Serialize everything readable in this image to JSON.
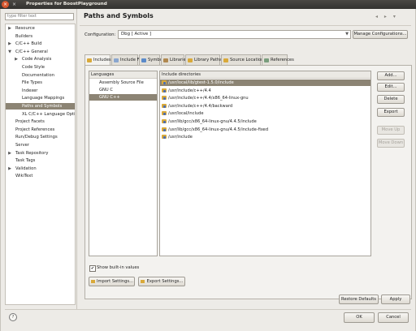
{
  "window": {
    "title": "Properties for BoostPlayground"
  },
  "filter": {
    "placeholder": "type filter text"
  },
  "tree": [
    {
      "label": "Resource",
      "expander": "▶",
      "depth": 0
    },
    {
      "label": "Builders",
      "expander": "",
      "depth": 0
    },
    {
      "label": "C/C++ Build",
      "expander": "▶",
      "depth": 0
    },
    {
      "label": "C/C++ General",
      "expander": "▼",
      "depth": 0
    },
    {
      "label": "Code Analysis",
      "expander": "▶",
      "depth": 1
    },
    {
      "label": "Code Style",
      "expander": "",
      "depth": 1
    },
    {
      "label": "Documentation",
      "expander": "",
      "depth": 1
    },
    {
      "label": "File Types",
      "expander": "",
      "depth": 1
    },
    {
      "label": "Indexer",
      "expander": "",
      "depth": 1
    },
    {
      "label": "Language Mappings",
      "expander": "",
      "depth": 1
    },
    {
      "label": "Paths and Symbols",
      "expander": "",
      "depth": 1,
      "selected": true
    },
    {
      "label": "XL C/C++ Language Opti",
      "expander": "",
      "depth": 1
    },
    {
      "label": "Project Facets",
      "expander": "",
      "depth": 0
    },
    {
      "label": "Project References",
      "expander": "",
      "depth": 0
    },
    {
      "label": "Run/Debug Settings",
      "expander": "",
      "depth": 0
    },
    {
      "label": "Server",
      "expander": "",
      "depth": 0
    },
    {
      "label": "Task Repository",
      "expander": "▶",
      "depth": 0
    },
    {
      "label": "Task Tags",
      "expander": "",
      "depth": 0
    },
    {
      "label": "Validation",
      "expander": "▶",
      "depth": 0
    },
    {
      "label": "WikiText",
      "expander": "",
      "depth": 0
    }
  ],
  "page": {
    "title": "Paths and Symbols",
    "header_icons": "◂ ▸ ▾"
  },
  "configuration": {
    "label": "Configuration:",
    "value": "Dbg  [ Active ]",
    "manage_button": "Manage Configurations..."
  },
  "tabs": [
    {
      "label": "Includes",
      "active": true,
      "icon_color": "#d9a93a"
    },
    {
      "label": "Include Files",
      "active": false,
      "icon_color": "#8aa6cf"
    },
    {
      "label": "Symbols",
      "active": false,
      "icon_color": "#5b8ac9"
    },
    {
      "label": "Libraries",
      "active": false,
      "icon_color": "#b08850"
    },
    {
      "label": "Library Paths",
      "active": false,
      "icon_color": "#d9a93a"
    },
    {
      "label": "Source Location",
      "active": false,
      "icon_color": "#d9a93a"
    },
    {
      "label": "References",
      "active": false,
      "icon_color": "#7a9e7e"
    }
  ],
  "languages": {
    "header": "Languages",
    "items": [
      {
        "label": "Assembly Source File",
        "selected": false
      },
      {
        "label": "GNU C",
        "selected": false
      },
      {
        "label": "GNU C++",
        "selected": true
      }
    ]
  },
  "include_dirs": {
    "header": "Include directories",
    "items": [
      {
        "path": "/usr/local/lib/gtest-1.5.0/include",
        "selected": true
      },
      {
        "path": "/usr/include/c++/4.4",
        "selected": false
      },
      {
        "path": "/usr/include/c++/4.4/x86_64-linux-gnu",
        "selected": false
      },
      {
        "path": "/usr/include/c++/4.4/backward",
        "selected": false
      },
      {
        "path": "/usr/local/include",
        "selected": false
      },
      {
        "path": "/usr/lib/gcc/x86_64-linux-gnu/4.4.5/include",
        "selected": false
      },
      {
        "path": "/usr/lib/gcc/x86_64-linux-gnu/4.4.5/include-fixed",
        "selected": false
      },
      {
        "path": "/usr/include",
        "selected": false
      }
    ]
  },
  "side_buttons": {
    "add": "Add...",
    "edit": "Edit...",
    "delete": "Delete",
    "export": "Export",
    "move_up": "Move Up",
    "move_down": "Move Down"
  },
  "show_builtin": {
    "label": "Show built-in values",
    "checked": true
  },
  "import_button": "Import Settings...",
  "export_button": "Export Settings...",
  "restore_button": "Restore Defaults",
  "apply_button": "Apply",
  "ok_button": "OK",
  "cancel_button": "Cancel",
  "help_icon_glyph": "?"
}
